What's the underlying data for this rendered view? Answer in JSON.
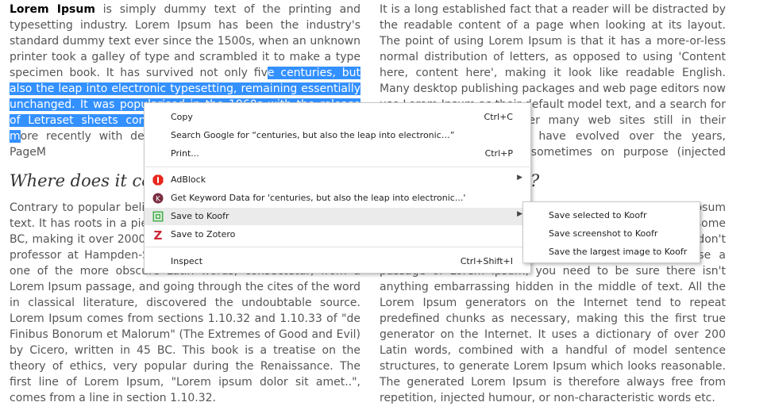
{
  "left_column": {
    "p1_bold": "Lorem Ipsum",
    "p1_text_a": " is simply dummy text of the printing and typesetting industry. Lorem Ipsum has been the industry's standard dummy text ever since the 1500s, when an unknown printer took a galley of type and scrambled it to make a type specimen book. It has survived not only fiv",
    "p1_selected": "e centuries, but also the leap into electronic typesetting, remaining essentially unchanged. It was popularised in the 1960s with the relea",
    "p1_hidden": "se of Letraset sheets containing Lorem Ipsum passages, and m",
    "p1_text_b": "ore recently with desktop publishing software like Aldus PageM",
    "heading": "Where does it come",
    "p2": "Contrary to popular belief, Lorem Ipsum is not simply random text. It has roots in a piece of classical Latin literature from 45 BC, making it over 2000 years old. Richard McClintock, a Latin professor at Hampden-Sydney College in Virginia, looked up one of the more obscure Latin words, consectetur, from a Lorem Ipsum passage, and going through the cites of the word in classical literature, discovered the undoubtable source. Lorem Ipsum comes from sections 1.10.32 and 1.10.33 of \"de Finibus Bonorum et Malorum\" (The Extremes of Good and Evil) by Cicero, written in 45 BC. This book is a treatise on the theory of ethics, very popular during the Renaissance. The first line of Lorem Ipsum, \"Lorem ipsum dolor sit amet..\", comes from a line in section 1.10.32."
  },
  "right_column": {
    "p1": "It is a long established fact that a reader will be distracted by the readable content of a page when looking at its layout. The point of using Lorem Ipsum is that it has a more-or-less normal distribution of letters, as opposed to using 'Content here, content here', making it look like readable English. Many desktop publishing packages and web page editors now use Lorem Ipsum as their default model text, and a search for 'lorem ipsum' will uncover many web sites still in their infancy. Various versions have evolved over the years, sometimes by accident, sometimes on purpose (injected humour and the like).",
    "heading": "?",
    "p2": "There are many variations of passages of Lorem Ipsum available, but the majority have suffered alteration in some form, by injected humour, or randomised words which don't look even slightly believable. If you are going to use a passage of Lorem Ipsum, you need to be sure there isn't anything embarrassing hidden in the middle of text. All the Lorem Ipsum generators on the Internet tend to repeat predefined chunks as necessary, making this the first true generator on the Internet. It uses a dictionary of over 200 Latin words, combined with a handful of model sentence structures, to generate Lorem Ipsum which looks reasonable. The generated Lorem Ipsum is therefore always free from repetition, injected humour, or non-characteristic words etc."
  },
  "context_menu": {
    "copy": "Copy",
    "copy_shortcut": "Ctrl+C",
    "search_google": "Search Google for “centuries, but also the leap into electronic…”",
    "print": "Print...",
    "print_shortcut": "Ctrl+P",
    "adblock": "AdBlock",
    "keyword": "Get Keyword Data for 'centuries, but also the leap into electronic...'",
    "koofr": "Save to Koofr",
    "zotero": "Save to Zotero",
    "inspect": "Inspect",
    "inspect_shortcut": "Ctrl+Shift+I"
  },
  "submenu": {
    "item1": "Save selected to Koofr",
    "item2": "Save screenshot to Koofr",
    "item3": "Save the largest image to Koofr"
  },
  "colors": {
    "selection": "#3390ff",
    "adblock": "#e8261c",
    "keyword": "#7a2d3e",
    "koofr": "#4caf50",
    "zotero": "#cc2936"
  },
  "icons": {
    "adblock": "adblock-icon",
    "keyword": "keyword-icon",
    "koofr": "koofr-icon",
    "zotero": "zotero-icon",
    "arrow": "chevron-right-icon"
  }
}
